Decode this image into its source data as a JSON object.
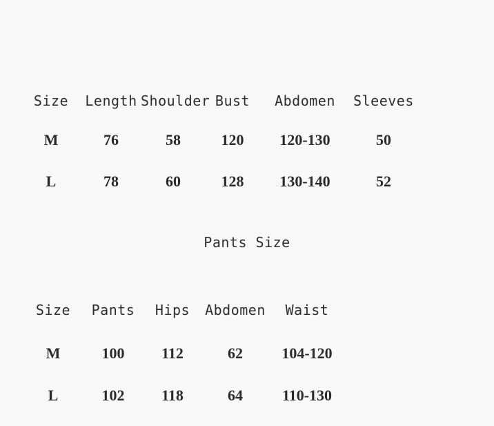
{
  "background_color": "#f8f8f8",
  "text_color": "#2a2a2a",
  "header_color": "#2e2e2e",
  "top_table": {
    "headers": {
      "size": "Size",
      "length": "Length",
      "shoulder": "Shoulder",
      "bust": "Bust",
      "abdomen": "Abdomen",
      "sleeves": "Sleeves"
    },
    "rows": [
      {
        "size": "M",
        "length": "76",
        "shoulder": "58",
        "bust": "120",
        "abdomen": "120-130",
        "sleeves": "50"
      },
      {
        "size": "L",
        "length": "78",
        "shoulder": "60",
        "bust": "128",
        "abdomen": "130-140",
        "sleeves": "52"
      }
    ]
  },
  "pants_section": {
    "title": "Pants Size",
    "headers": {
      "size": "Size",
      "pants": "Pants",
      "hips": "Hips",
      "abdomen": "Abdomen",
      "waist": "Waist"
    },
    "rows": [
      {
        "size": "M",
        "pants": "100",
        "hips": "112",
        "abdomen": "62",
        "waist": "104-120"
      },
      {
        "size": "L",
        "pants": "102",
        "hips": "118",
        "abdomen": "64",
        "waist": "110-130"
      }
    ]
  }
}
